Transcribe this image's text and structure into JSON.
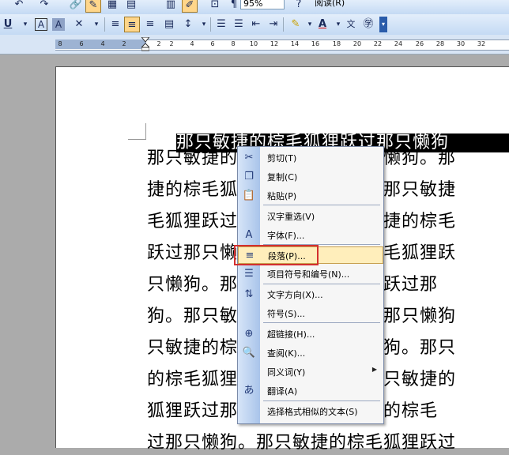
{
  "toolbar_top": {
    "zoom": "95%",
    "reading_mode": "阅读(R)"
  },
  "toolbar_format": {
    "icons": [
      "underline",
      "dropdown",
      "char-border",
      "char-shading",
      "char-scale",
      "dropdown",
      "align-left",
      "align-center",
      "align-right",
      "distributed",
      "line-spacing",
      "numbering",
      "bullets",
      "decrease-indent",
      "increase-indent",
      "highlight",
      "font-color",
      "phonetic-guide",
      "enclosed-char"
    ]
  },
  "ruler": {
    "labels": [
      "8",
      "6",
      "4",
      "2",
      "2",
      "2",
      "4",
      "6",
      "8",
      "10",
      "12",
      "14",
      "16",
      "18",
      "20",
      "22",
      "24",
      "26",
      "28",
      "30",
      "32"
    ]
  },
  "document": {
    "selected_line": "那只敏捷的棕毛狐狸跃过那只懒狗",
    "lines": [
      "那只敏捷的棕毛狐狸跃过那只懒狗。那",
      "捷的棕毛狐狸跃过那只懒狗。那只敏捷",
      "毛狐狸跃过那只懒狗。那只敏捷的棕毛",
      "跃过那只懒狗。那只敏捷的棕毛狐狸跃",
      "只懒狗。那只敏捷的棕毛狐狸跃过那",
      "狗。那只敏捷的棕毛狐狸跃过那只懒狗",
      "只敏捷的棕毛狐狸跃过那只懒狗。那只",
      "的棕毛狐狸跃过那只懒狗。那只敏捷的",
      "狐狸跃过那只懒狗。那只敏捷的棕毛",
      "过那只懒狗。那只敏捷的棕毛狐狸跃过"
    ]
  },
  "context_menu": {
    "items": [
      {
        "label": "剪切(T)",
        "icon": "scissors-icon"
      },
      {
        "label": "复制(C)",
        "icon": "copy-icon"
      },
      {
        "label": "粘贴(P)",
        "icon": "paste-icon"
      },
      {
        "label": "汉字重选(V)",
        "icon": ""
      },
      {
        "label": "字体(F)...",
        "icon": "font-icon"
      },
      {
        "label": "段落(P)...",
        "icon": "paragraph-icon",
        "highlighted": true
      },
      {
        "label": "项目符号和编号(N)...",
        "icon": "bullets-icon"
      },
      {
        "label": "文字方向(X)...",
        "icon": "text-direction-icon"
      },
      {
        "label": "符号(S)...",
        "icon": ""
      },
      {
        "label": "超链接(H)...",
        "icon": "hyperlink-icon"
      },
      {
        "label": "查阅(K)...",
        "icon": "research-icon"
      },
      {
        "label": "同义词(Y)",
        "icon": "",
        "submenu": true
      },
      {
        "label": "翻译(A)",
        "icon": "translate-icon"
      },
      {
        "label": "选择格式相似的文本(S)",
        "icon": ""
      }
    ]
  },
  "colors": {
    "highlight_box": "#d32f2f",
    "menu_highlight": "#ffeebb"
  }
}
